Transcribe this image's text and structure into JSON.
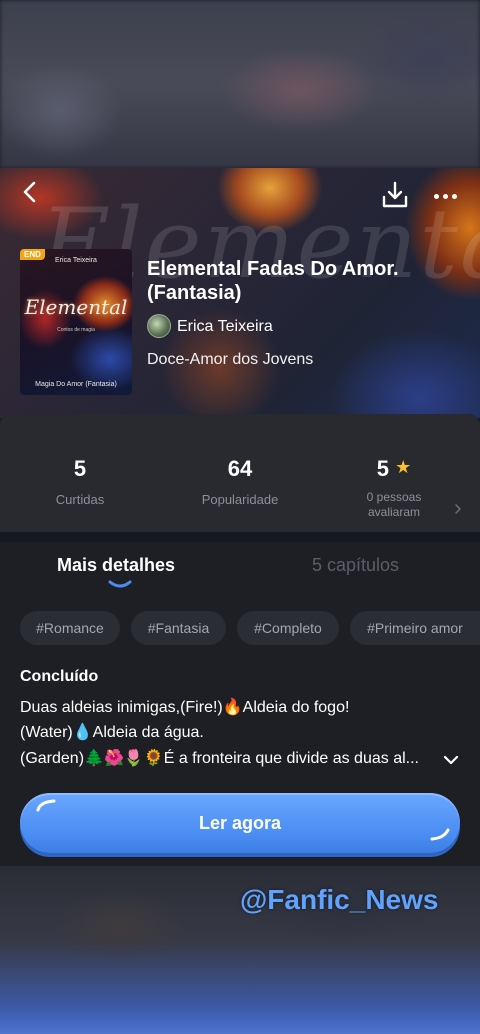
{
  "colors": {
    "accent": "#4a8cf2",
    "star": "#f6c12a",
    "badge": "#f2a516",
    "panel": "#1d1f25",
    "watermark": "#5fa3ff"
  },
  "header": {
    "back_icon": "chevron-left-icon",
    "download_icon": "download-icon",
    "more_icon": "more-horizontal-icon",
    "banner_text": "Elemental"
  },
  "cover": {
    "badge": "END",
    "author": "Erica Teixeira",
    "title": "Elemental",
    "tagline": "Contos de magia",
    "subtitle": "Magia Do Amor (Fantasia)"
  },
  "book": {
    "title": "Elemental Fadas Do Amor. (Fantasia)",
    "author": "Erica Teixeira",
    "category": "Doce-Amor dos Jovens"
  },
  "stats": {
    "likes_value": "5",
    "likes_label": "Curtidas",
    "popularity_value": "64",
    "popularity_label": "Popularidade",
    "rating_value": "5",
    "rating_star": "★",
    "rating_label_1": "0 pessoas",
    "rating_label_2": "avaliaram"
  },
  "tabs": {
    "details": "Mais detalhes",
    "chapters": "5 capítulos"
  },
  "tags": [
    "#Romance",
    "#Fantasia",
    "#Completo",
    "#Primeiro amor"
  ],
  "description": {
    "status": "Concluído",
    "line1": "Duas aldeias inimigas,(Fire!)🔥Aldeia do fogo!",
    "line2": "(Water)💧Aldeia da água.",
    "line3": "(Garden)🌲🌺🌷🌻É a fronteira que divide as duas al..."
  },
  "read_button": "Ler agora",
  "overlay_handle": "@Fanfic_News"
}
